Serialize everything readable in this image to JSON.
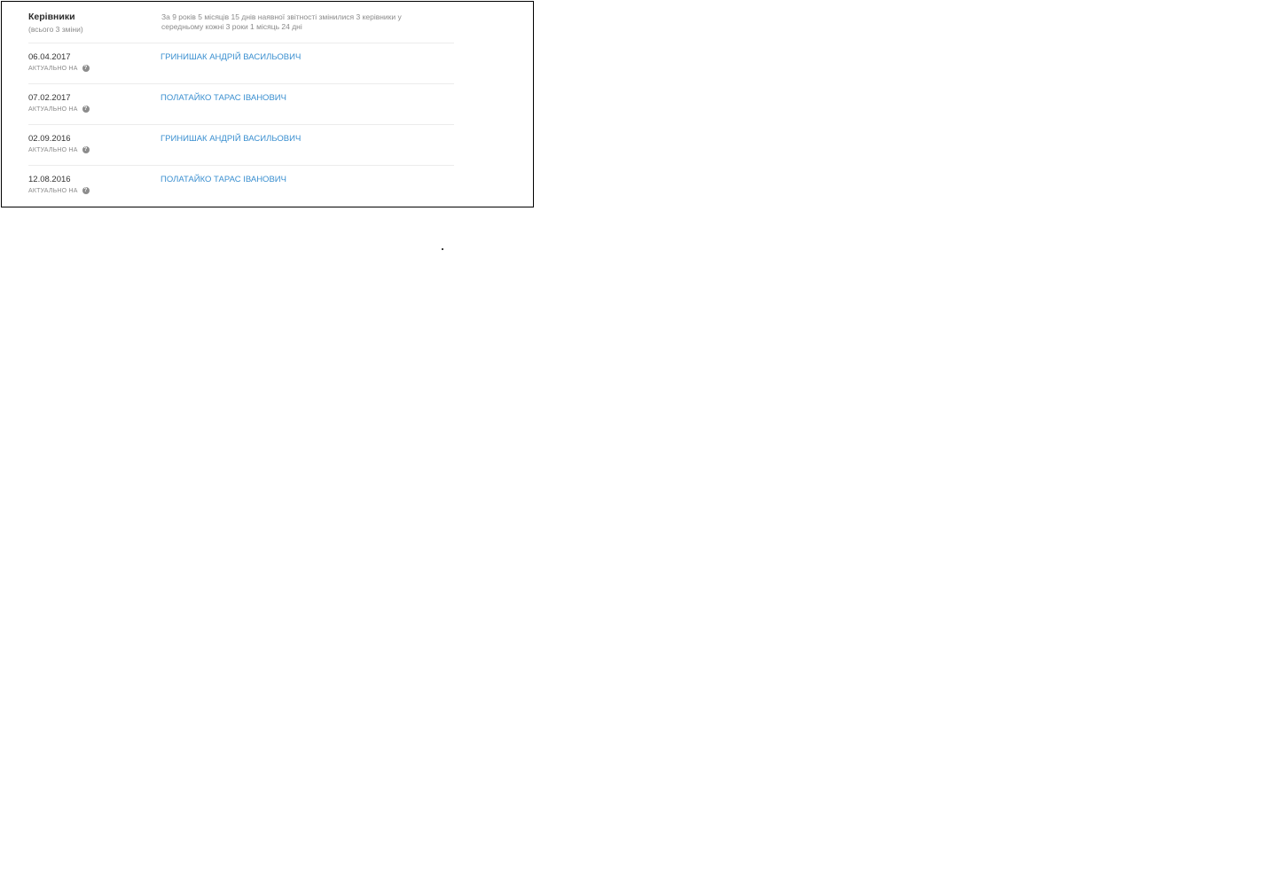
{
  "section": {
    "title": "Керівники",
    "subtitle": "(всього 3 зміни)",
    "summary": "За 9 років 5 місяців 15 днів наявної звітності змінилися 3 керівники у середньому кожні 3 роки 1 місяць 24 дні"
  },
  "actual_label": "АКТУАЛЬНО НА",
  "help_icon": "question-circle-icon",
  "colors": {
    "link": "#3a8fd0",
    "muted": "#8a8a8a",
    "text": "#333333"
  },
  "rows": [
    {
      "date": "06.04.2017",
      "name": "ГРИНИШАК АНДРІЙ ВАСИЛЬОВИЧ"
    },
    {
      "date": "07.02.2017",
      "name": "ПОЛАТАЙКО ТАРАС ІВАНОВИЧ"
    },
    {
      "date": "02.09.2016",
      "name": "ГРИНИШАК АНДРІЙ ВАСИЛЬОВИЧ"
    },
    {
      "date": "12.08.2016",
      "name": "ПОЛАТАЙКО ТАРАС ІВАНОВИЧ"
    }
  ]
}
